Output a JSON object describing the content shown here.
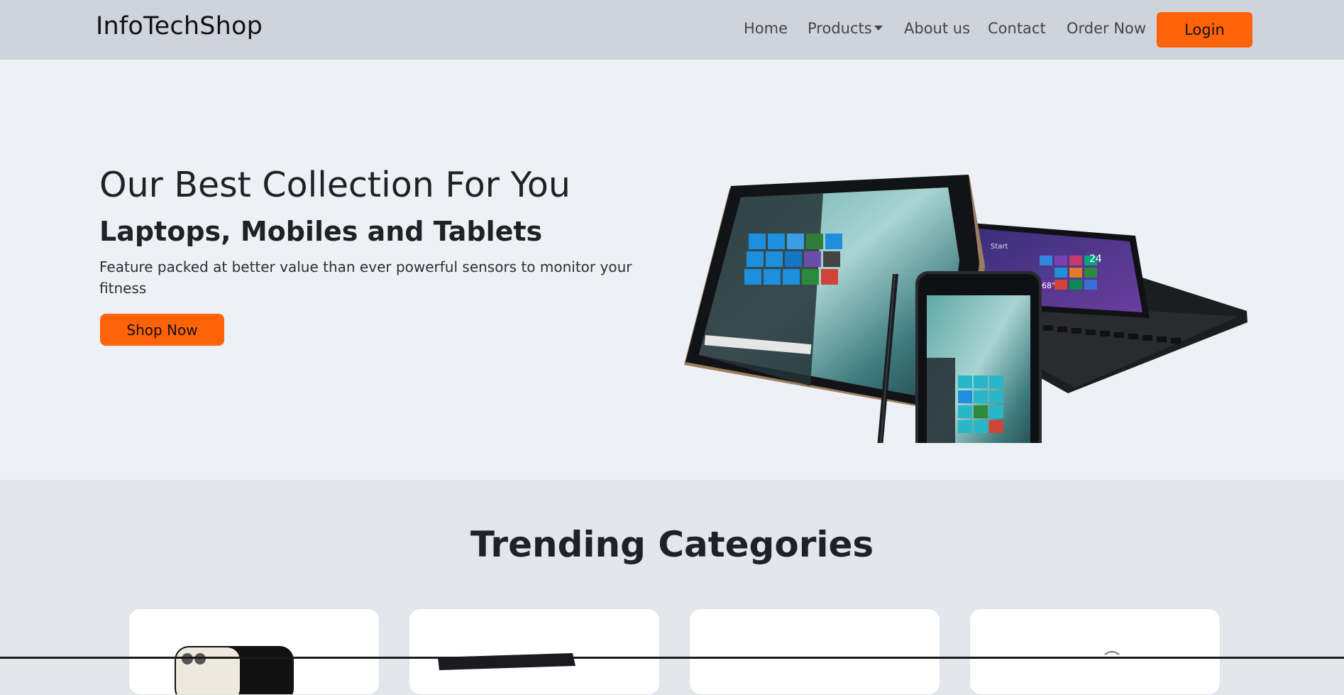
{
  "navbar": {
    "brand": "InfoTechShop",
    "links": [
      {
        "label": "Home"
      },
      {
        "label": "Products",
        "has_dropdown": true
      },
      {
        "label": "About us"
      },
      {
        "label": "Contact"
      },
      {
        "label": "Order Now"
      }
    ],
    "login_label": "Login"
  },
  "hero": {
    "title": "Our Best Collection For You",
    "subtitle": "Laptops, Mobiles and Tablets",
    "description": "Feature packed at better value than ever powerful sensors to monitor your fitness",
    "cta_label": "Shop Now",
    "tablet_start_text": "Start",
    "tablet_temp_text": "68°",
    "tablet_day_text": "24"
  },
  "trending": {
    "title": "Trending Categories"
  },
  "colors": {
    "accent": "#ff630a",
    "navbar_bg": "#cfd4dc",
    "hero_bg": "#edf1f5",
    "section_bg": "#e3e7eb"
  }
}
